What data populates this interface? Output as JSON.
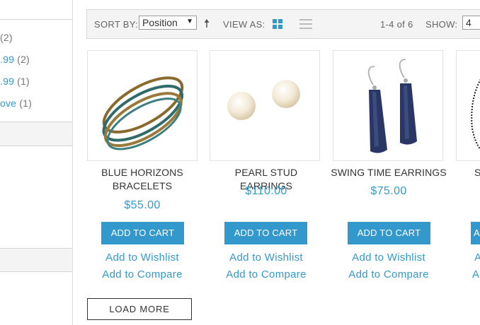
{
  "sidebar": {
    "items": [
      {
        "label": "",
        "count": "(2)"
      },
      {
        "label": ".99",
        "count": "(2)"
      },
      {
        "label": ".99",
        "count": "(1)"
      },
      {
        "label": "ove",
        "count": "(1)"
      }
    ]
  },
  "toolbar": {
    "sort_label": "SORT BY:",
    "sort_value": "Position",
    "view_label": "VIEW AS:",
    "range_text": "1-4 of 6",
    "show_label": "SHOW:",
    "show_value": "4"
  },
  "products": [
    {
      "name_line1": "BLUE HORIZONS",
      "name_line2": "BRACELETS",
      "price": "$55.00",
      "cart": "ADD TO CART",
      "wishlist": "Add to Wishlist",
      "compare": "Add to Compare"
    },
    {
      "name_line1": "PEARL STUD EARRINGS",
      "name_line2": "",
      "price": "$110.00",
      "cart": "ADD TO CART",
      "wishlist": "Add to Wishlist",
      "compare": "Add to Compare"
    },
    {
      "name_line1": "SWING TIME EARRINGS",
      "name_line2": "",
      "price": "$75.00",
      "cart": "ADD TO CART",
      "wishlist": "Add to Wishlist",
      "compare": "Add to Compare"
    },
    {
      "name_line1": "S",
      "name_line2": "",
      "price": "",
      "cart": "A",
      "wishlist": "A",
      "compare": "A"
    }
  ],
  "load_more": "LOAD MORE",
  "colors": {
    "accent": "#3399cc",
    "toolbar_bg": "#f4f4f4"
  }
}
